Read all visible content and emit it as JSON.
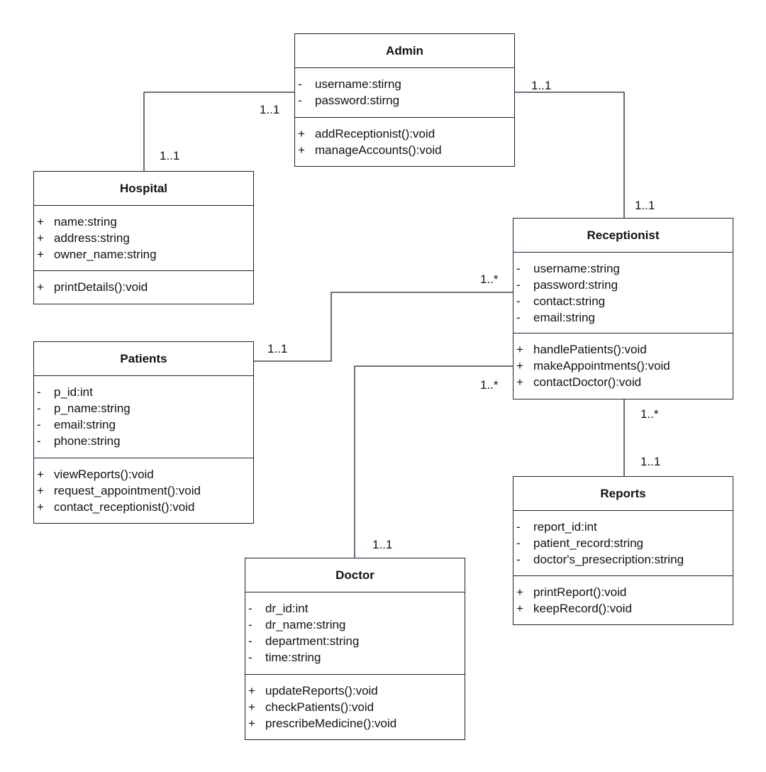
{
  "classes": [
    {
      "id": "admin",
      "name": "Admin",
      "attributes": [
        {
          "vis": "-",
          "text": "username:stirng"
        },
        {
          "vis": "-",
          "text": "password:stirng"
        }
      ],
      "methods": [
        {
          "vis": "+",
          "text": "addReceptionist():void"
        },
        {
          "vis": "+",
          "text": "manageAccounts():void"
        }
      ]
    },
    {
      "id": "hospital",
      "name": "Hospital",
      "attributes": [
        {
          "vis": "+",
          "text": "name:string"
        },
        {
          "vis": "+",
          "text": "address:string"
        },
        {
          "vis": "+",
          "text": "owner_name:string"
        }
      ],
      "methods": [
        {
          "vis": "+",
          "text": "printDetails():void"
        }
      ]
    },
    {
      "id": "receptionist",
      "name": "Receptionist",
      "attributes": [
        {
          "vis": "-",
          "text": "username:string"
        },
        {
          "vis": "-",
          "text": "password:string"
        },
        {
          "vis": "-",
          "text": "contact:string"
        },
        {
          "vis": "-",
          "text": "email:string"
        }
      ],
      "methods": [
        {
          "vis": "+",
          "text": "handlePatients():void"
        },
        {
          "vis": "+",
          "text": "makeAppointments():void"
        },
        {
          "vis": "+",
          "text": "contactDoctor():void"
        }
      ]
    },
    {
      "id": "patients",
      "name": "Patients",
      "attributes": [
        {
          "vis": "-",
          "text": "p_id:int"
        },
        {
          "vis": "-",
          "text": "p_name:string"
        },
        {
          "vis": "-",
          "text": "email:string"
        },
        {
          "vis": "-",
          "text": "phone:string"
        }
      ],
      "methods": [
        {
          "vis": "+",
          "text": "viewReports():void"
        },
        {
          "vis": "+",
          "text": "request_appointment():void"
        },
        {
          "vis": "+",
          "text": "contact_receptionist():void"
        }
      ]
    },
    {
      "id": "reports",
      "name": "Reports",
      "attributes": [
        {
          "vis": "-",
          "text": "report_id:int"
        },
        {
          "vis": "-",
          "text": "patient_record:string"
        },
        {
          "vis": "-",
          "text": "doctor's_presecription:string"
        }
      ],
      "methods": [
        {
          "vis": "+",
          "text": "printReport():void"
        },
        {
          "vis": "+",
          "text": "keepRecord():void"
        }
      ]
    },
    {
      "id": "doctor",
      "name": "Doctor",
      "attributes": [
        {
          "vis": "-",
          "text": "dr_id:int"
        },
        {
          "vis": "-",
          "text": "dr_name:string"
        },
        {
          "vis": "-",
          "text": "department:string"
        },
        {
          "vis": "-",
          "text": "time:string"
        }
      ],
      "methods": [
        {
          "vis": "+",
          "text": "updateReports():void"
        },
        {
          "vis": "+",
          "text": "checkPatients():void"
        },
        {
          "vis": "+",
          "text": "prescribeMedicine():void"
        }
      ]
    }
  ],
  "associations": [
    {
      "id": "admin-hospital",
      "from": "admin",
      "to": "hospital",
      "from_mult": "1..1",
      "to_mult": "1..1"
    },
    {
      "id": "admin-receptionist",
      "from": "admin",
      "to": "receptionist",
      "from_mult": "1..1",
      "to_mult": "1..1"
    },
    {
      "id": "patients-receptionist",
      "from": "patients",
      "to": "receptionist",
      "from_mult": "1..1",
      "to_mult": "1..*"
    },
    {
      "id": "doctor-receptionist",
      "from": "doctor",
      "to": "receptionist",
      "from_mult": "1..1",
      "to_mult": "1..*"
    },
    {
      "id": "reports-receptionist",
      "from": "reports",
      "to": "receptionist",
      "from_mult": "1..1",
      "to_mult": "1..*"
    }
  ],
  "colors": {
    "line": "#1c1c3c",
    "text": "#111111",
    "background": "#ffffff"
  }
}
